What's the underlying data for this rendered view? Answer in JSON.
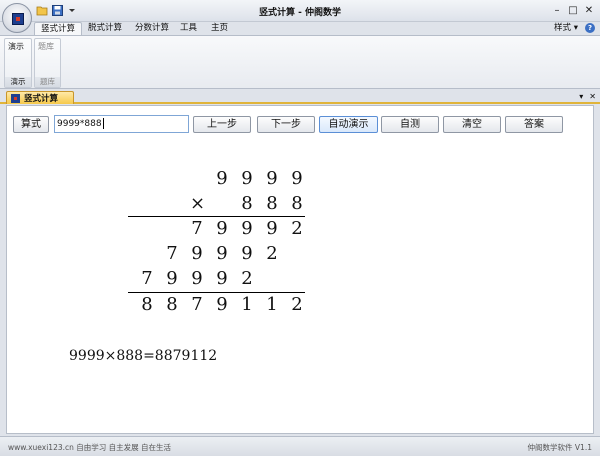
{
  "window": {
    "title": "竖式计算 - 仲阁数学",
    "controls": {
      "minimize": "–",
      "maximize": "□",
      "close": "✕"
    }
  },
  "qat": {
    "icons": [
      "open-folder-icon",
      "save-icon",
      "dropdown-icon"
    ]
  },
  "ribbon": {
    "tabs": [
      "竖式计算",
      "脱式计算",
      "分数计算",
      "工具",
      "主页"
    ],
    "active_tab": "竖式计算",
    "style_menu": "样式 ▾",
    "groups": [
      {
        "item": "演示",
        "label": "演示",
        "enabled": true
      },
      {
        "item": "题库",
        "label": "题库",
        "enabled": false
      }
    ]
  },
  "document_tab": {
    "label": "竖式计算",
    "controls": [
      "▾",
      "✕"
    ]
  },
  "toolbar": {
    "formula_button": "算式",
    "expression": "9999*888",
    "prev_step": "上一步",
    "next_step": "下一步",
    "auto_demo": "自动演示",
    "self_test": "自测",
    "clear": "清空",
    "answer": "答案"
  },
  "calculation": {
    "multiplicand": [
      "9",
      "9",
      "9",
      "9"
    ],
    "operator": "×",
    "multiplier": [
      "8",
      "8",
      "8"
    ],
    "partial_1": [
      "7",
      "9",
      "9",
      "9",
      "2"
    ],
    "partial_2": [
      "7",
      "9",
      "9",
      "9",
      "2"
    ],
    "partial_3": [
      "7",
      "9",
      "9",
      "9",
      "2"
    ],
    "product": [
      "8",
      "8",
      "7",
      "9",
      "1",
      "1",
      "2"
    ],
    "result_line": "9999×888=8879112"
  },
  "status": {
    "left": "www.xuexi123.cn 自由学习 自主发展 自在生活",
    "right": "仲阁数学软件 V1.1"
  }
}
